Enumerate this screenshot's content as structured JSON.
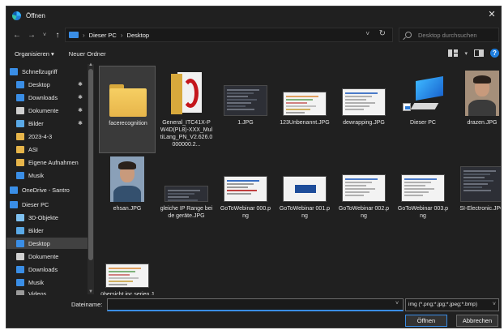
{
  "window": {
    "title": "Öffnen",
    "close_glyph": "✕"
  },
  "nav": {
    "back": "←",
    "forward": "→",
    "recent": "˅",
    "up": "↑",
    "breadcrumb": [
      "Dieser PC",
      "Desktop"
    ],
    "sep": "›",
    "addr_dropdown": "˅",
    "refresh": "↻",
    "search_placeholder": "Desktop durchsuchen"
  },
  "toolbar": {
    "organize": "Organisieren ▾",
    "new_folder": "Neuer Ordner",
    "help": "?",
    "chev": "▾"
  },
  "sidebar": {
    "items": [
      {
        "label": "Schnellzugriff",
        "icon": "star-icon",
        "color": "#3a8ee6",
        "pinned": false
      },
      {
        "label": "Desktop",
        "icon": "desktop-icon",
        "color": "#3a8ee6",
        "pinned": true
      },
      {
        "label": "Downloads",
        "icon": "download-icon",
        "color": "#3a8ee6",
        "pinned": true
      },
      {
        "label": "Dokumente",
        "icon": "document-icon",
        "color": "#d0d0d0",
        "pinned": true
      },
      {
        "label": "Bilder",
        "icon": "pictures-icon",
        "color": "#5aa9e6",
        "pinned": true
      },
      {
        "label": "2023-4-3",
        "icon": "folder-icon",
        "color": "#e7b54a",
        "pinned": false
      },
      {
        "label": "ASI",
        "icon": "folder-icon",
        "color": "#e7b54a",
        "pinned": false
      },
      {
        "label": "Eigene Aufnahmen",
        "icon": "folder-icon",
        "color": "#e7b54a",
        "pinned": false
      },
      {
        "label": "Musik",
        "icon": "music-icon",
        "color": "#3a8ee6",
        "pinned": false
      },
      {
        "label": "OneDrive - Santro",
        "icon": "cloud-icon",
        "color": "#3a8ee6",
        "pinned": false
      },
      {
        "label": "Dieser PC",
        "icon": "pc-icon",
        "color": "#3a8ee6",
        "pinned": false
      },
      {
        "label": "3D-Objekte",
        "icon": "cube-icon",
        "color": "#7fc1f0",
        "pinned": false
      },
      {
        "label": "Bilder",
        "icon": "pictures-icon",
        "color": "#5aa9e6",
        "pinned": false
      },
      {
        "label": "Desktop",
        "icon": "desktop-icon",
        "color": "#3a8ee6",
        "pinned": false,
        "selected": true
      },
      {
        "label": "Dokumente",
        "icon": "document-icon",
        "color": "#d0d0d0",
        "pinned": false
      },
      {
        "label": "Downloads",
        "icon": "download-icon",
        "color": "#3a8ee6",
        "pinned": false
      },
      {
        "label": "Musik",
        "icon": "music-icon",
        "color": "#3a8ee6",
        "pinned": false
      },
      {
        "label": "Videos",
        "icon": "video-icon",
        "color": "#9a9a9a",
        "pinned": false
      }
    ],
    "pin_glyph": "✱",
    "scroll_up": "▲",
    "scroll_down": "▼"
  },
  "files": [
    {
      "name": "facerecognition",
      "kind": "folder",
      "selected": true
    },
    {
      "name": "General_ITC41X-PW4D(PL8)-XXX_MultiLang_PN_V2.626.0000000.2...",
      "kind": "pdf"
    },
    {
      "name": "1.JPG",
      "kind": "shot-dark"
    },
    {
      "name": "123Unbenannt.JPG",
      "kind": "shot-light-table"
    },
    {
      "name": "dewrapping.JPG",
      "kind": "shot-light"
    },
    {
      "name": "Dieser PC",
      "kind": "pc"
    },
    {
      "name": "drazen.JPG",
      "kind": "photo-a"
    },
    {
      "name": "ehsan.JPG",
      "kind": "photo-b"
    },
    {
      "name": "gleiche IP Range beide geräte.JPG",
      "kind": "shot-dark-strip"
    },
    {
      "name": "GoToWebinar 000.png",
      "kind": "shot-light-doc"
    },
    {
      "name": "GoToWebinar 001.png",
      "kind": "shot-light-blue"
    },
    {
      "name": "GoToWebinar 002.png",
      "kind": "shot-light-list"
    },
    {
      "name": "GoToWebinar 003.png",
      "kind": "shot-light-list"
    },
    {
      "name": "SI-Electronic.JPG",
      "kind": "shot-dark-list"
    },
    {
      "name": "übersicht ipc serien.JPG",
      "kind": "shot-light-table"
    }
  ],
  "bottom": {
    "filename_label": "Dateiname:",
    "filename_value": "",
    "filename_chev": "˅",
    "filter": "img (*.png;*.jpg;*.jpeg;*.bmp)",
    "filter_chev": "˅",
    "open_label": "Öffnen",
    "cancel_label": "Abbrechen"
  }
}
